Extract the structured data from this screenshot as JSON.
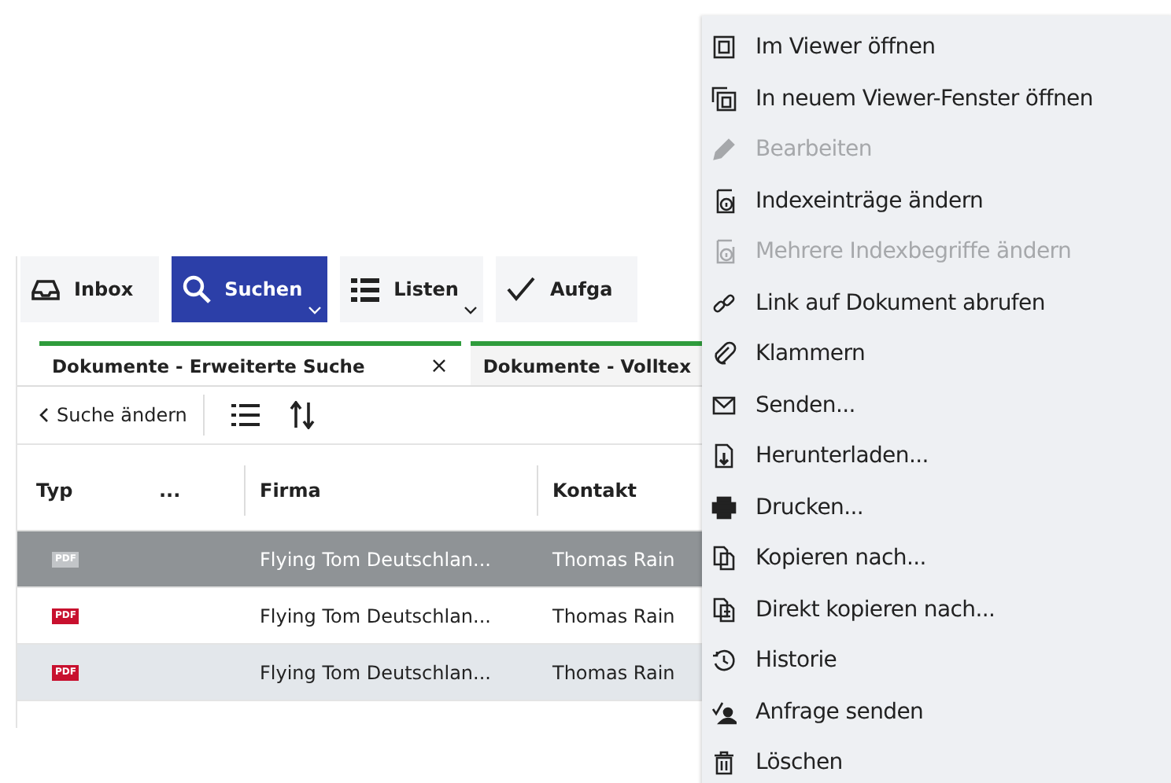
{
  "toolbar": [
    {
      "label": "Inbox",
      "kind": "inbox",
      "selected": false,
      "dropdown": false
    },
    {
      "label": "Suchen",
      "kind": "search",
      "selected": true,
      "dropdown": true
    },
    {
      "label": "Listen",
      "kind": "list",
      "selected": false,
      "dropdown": true
    },
    {
      "label": "Aufga",
      "kind": "check",
      "selected": false,
      "dropdown": false
    }
  ],
  "tabs": [
    {
      "label": "Dokumente - Erweiterte Suche",
      "close": "×",
      "selected": true
    },
    {
      "label": "Dokumente - Volltex",
      "selected": false
    }
  ],
  "actions": {
    "back": "Suche ändern"
  },
  "table": {
    "columns": [
      "Typ",
      "...",
      "Firma",
      "Kontakt"
    ],
    "rows": [
      {
        "type": "PDF",
        "firma": "Flying Tom Deutschlan...",
        "kontakt": "Thomas Rain",
        "selected": true,
        "hovered": false
      },
      {
        "type": "PDF",
        "firma": "Flying Tom Deutschlan...",
        "kontakt": "Thomas Rain",
        "selected": false,
        "hovered": false
      },
      {
        "type": "PDF",
        "firma": "Flying Tom Deutschlan...",
        "kontakt": "Thomas Rain",
        "selected": false,
        "hovered": true
      }
    ]
  },
  "context_menu": [
    {
      "kind": "viewer",
      "label": "Im Viewer öffnen",
      "disabled": false
    },
    {
      "kind": "viewer-new",
      "label": "In neuem Viewer-Fenster öffnen",
      "disabled": false
    },
    {
      "kind": "pencil",
      "label": "Bearbeiten",
      "disabled": true
    },
    {
      "kind": "index",
      "label": "Indexeinträge ändern",
      "disabled": false
    },
    {
      "kind": "index",
      "label": "Mehrere Indexbegriffe ändern",
      "disabled": true
    },
    {
      "kind": "link",
      "label": "Link auf Dokument abrufen",
      "disabled": false
    },
    {
      "kind": "clip",
      "label": "Klammern",
      "disabled": false
    },
    {
      "kind": "mail",
      "label": "Senden...",
      "disabled": false
    },
    {
      "kind": "download",
      "label": "Herunterladen...",
      "disabled": false
    },
    {
      "kind": "print",
      "label": "Drucken...",
      "disabled": false
    },
    {
      "kind": "copy",
      "label": "Kopieren nach...",
      "disabled": false
    },
    {
      "kind": "copy-direct",
      "label": "Direkt kopieren nach...",
      "disabled": false
    },
    {
      "kind": "history",
      "label": "Historie",
      "disabled": false
    },
    {
      "kind": "request",
      "label": "Anfrage senden",
      "disabled": false
    },
    {
      "kind": "trash",
      "label": "Löschen",
      "disabled": false
    }
  ]
}
